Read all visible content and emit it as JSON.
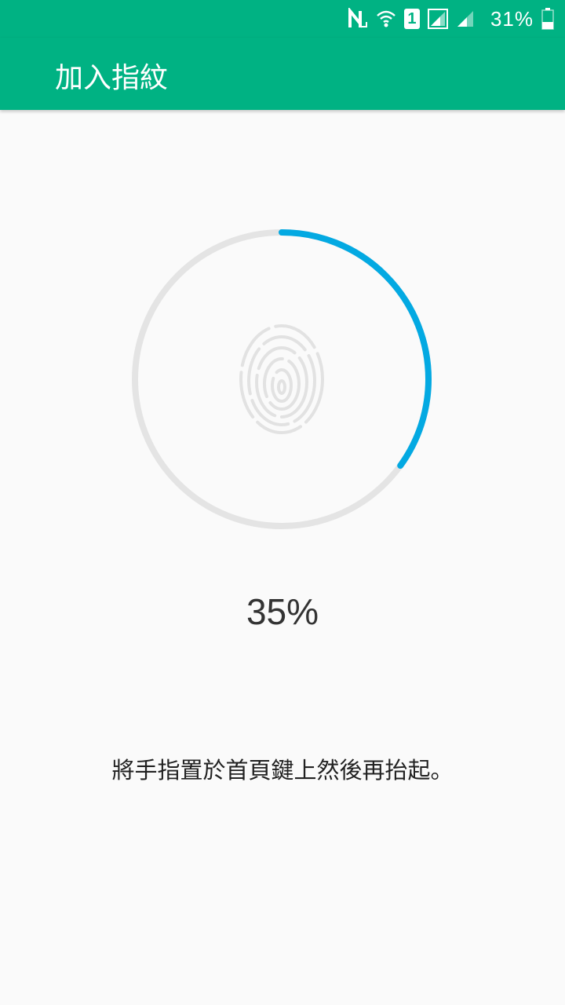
{
  "status_bar": {
    "battery_percent": "31%",
    "sim_slot": "1",
    "icons": [
      "nfc-icon",
      "wifi-icon",
      "sim-1-icon",
      "signal-icon",
      "signal-2-icon",
      "battery-icon"
    ]
  },
  "app_bar": {
    "title": "加入指紋"
  },
  "enrollment": {
    "progress_percent": 35,
    "progress_label": "35%",
    "instruction": "將手指置於首頁鍵上然後再抬起。"
  },
  "colors": {
    "header": "#00b283",
    "progress": "#03a9e2",
    "track": "#e4e4e4",
    "fingerprint": "#e2e2e2"
  }
}
